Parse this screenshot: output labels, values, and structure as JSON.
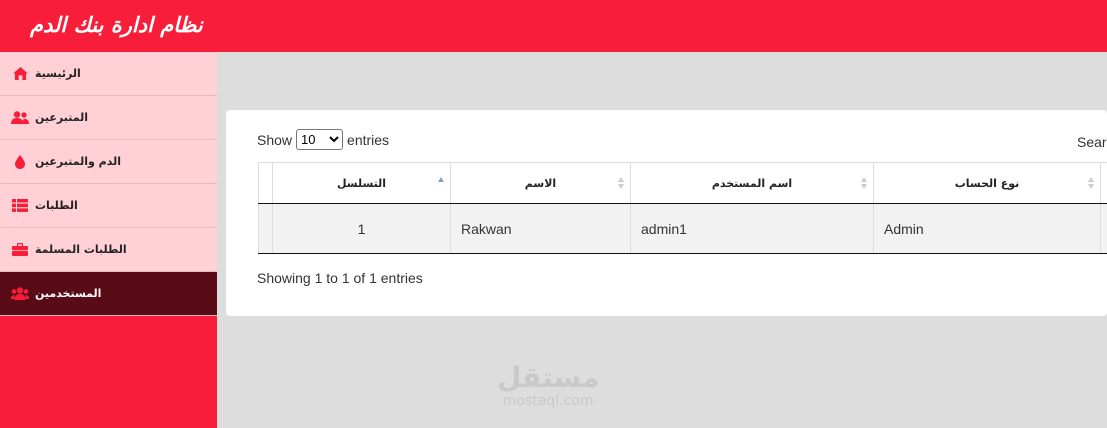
{
  "header": {
    "title": "نظام ادارة بنك الدم"
  },
  "sidebar": {
    "items": [
      {
        "label": "الرئيسية",
        "icon": "home-icon",
        "active": false
      },
      {
        "label": "المتبرعين",
        "icon": "users-icon",
        "active": false
      },
      {
        "label": "الدم والمتبرعين",
        "icon": "blood-drop-icon",
        "active": false
      },
      {
        "label": "الطلبات",
        "icon": "list-icon",
        "active": false
      },
      {
        "label": "الطلبات المسلمة",
        "icon": "toolbox-icon",
        "active": false
      },
      {
        "label": "المستخدمين",
        "icon": "users-icon",
        "active": true
      }
    ]
  },
  "table_controls": {
    "show_label": "Show",
    "entries_label": "entries",
    "page_length": "10",
    "page_length_options": [
      "10"
    ],
    "search_label": "Sear"
  },
  "table": {
    "columns": [
      "التسلسل",
      "الاسم",
      "اسم المستخدم",
      "نوع الحساب"
    ],
    "rows": [
      [
        "1",
        "Rakwan",
        "admin1",
        "Admin"
      ]
    ],
    "info": "Showing 1 to 1 of 1 entries"
  },
  "watermark": {
    "arabic": "مستقل",
    "latin": "mostaql.com"
  },
  "colors": {
    "brand": "#f81e3a",
    "sidebar_item": "#ffd1d6",
    "sidebar_active": "#5a0c16"
  }
}
